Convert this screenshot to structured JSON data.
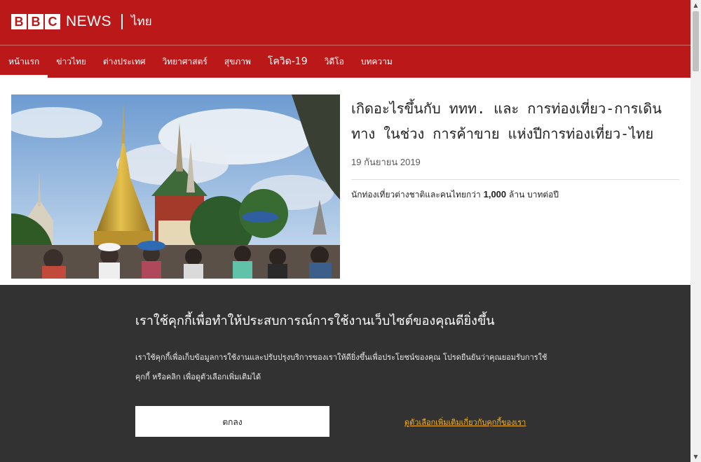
{
  "brand": {
    "bbc_letters": [
      "B",
      "B",
      "C"
    ],
    "news_word": "NEWS",
    "language_word": "ไทย",
    "brand_color": "#bb1919"
  },
  "nav": {
    "items": [
      {
        "label": "หน้าแรก",
        "active": true
      },
      {
        "label": "ข่าวไทย",
        "active": false
      },
      {
        "label": "ต่างประเทศ",
        "active": false
      },
      {
        "label": "วิทยาศาสตร์",
        "active": false
      },
      {
        "label": "สุขภาพ",
        "active": false
      },
      {
        "label": "โควิด-19",
        "active": false
      },
      {
        "label": "วิดีโอ",
        "active": false
      },
      {
        "label": "บทความ",
        "active": false
      }
    ]
  },
  "article": {
    "image_alt": "นักท่องเที่ยวที่วัดพระแก้ว",
    "headline": "เกิดอะไรขึ้นกับ ททท. และ การท่องเที่ยว-การเดินทาง ในช่วง การค้าขาย แห่งปีการท่องเที่ยว-ไทย",
    "date": "19 กันยายน 2019",
    "summary_text": "นักท่องเที่ยวต่างชาติและคนไทยกว่า",
    "summary_bold": "1,000",
    "summary_tail": "ล้าน บาทต่อปี"
  },
  "consent": {
    "title": "เราใช้คุกกี้เพื่อทำให้ประสบการณ์การใช้งานเว็บไซต์ของคุณดียิ่งขึ้น",
    "body": "เราใช้คุกกี้เพื่อเก็บข้อมูลการใช้งานและปรับปรุงบริการของเราให้ดียิ่งขึ้นเพื่อประโยชน์ของคุณ โปรดยืนยันว่าคุณยอมรับการใช้คุกกี้ หรือคลิก เพื่อดูตัวเลือกเพิ่มเติมได้",
    "ok_label": "ตกลง",
    "options_label": "ดูตัวเลือกเพิ่มเติมเกี่ยวกับคุกกี้ของเรา",
    "accent": "#fdb41d"
  },
  "scrollbar": {
    "up_arrow": "▲",
    "down_arrow": "▼"
  }
}
